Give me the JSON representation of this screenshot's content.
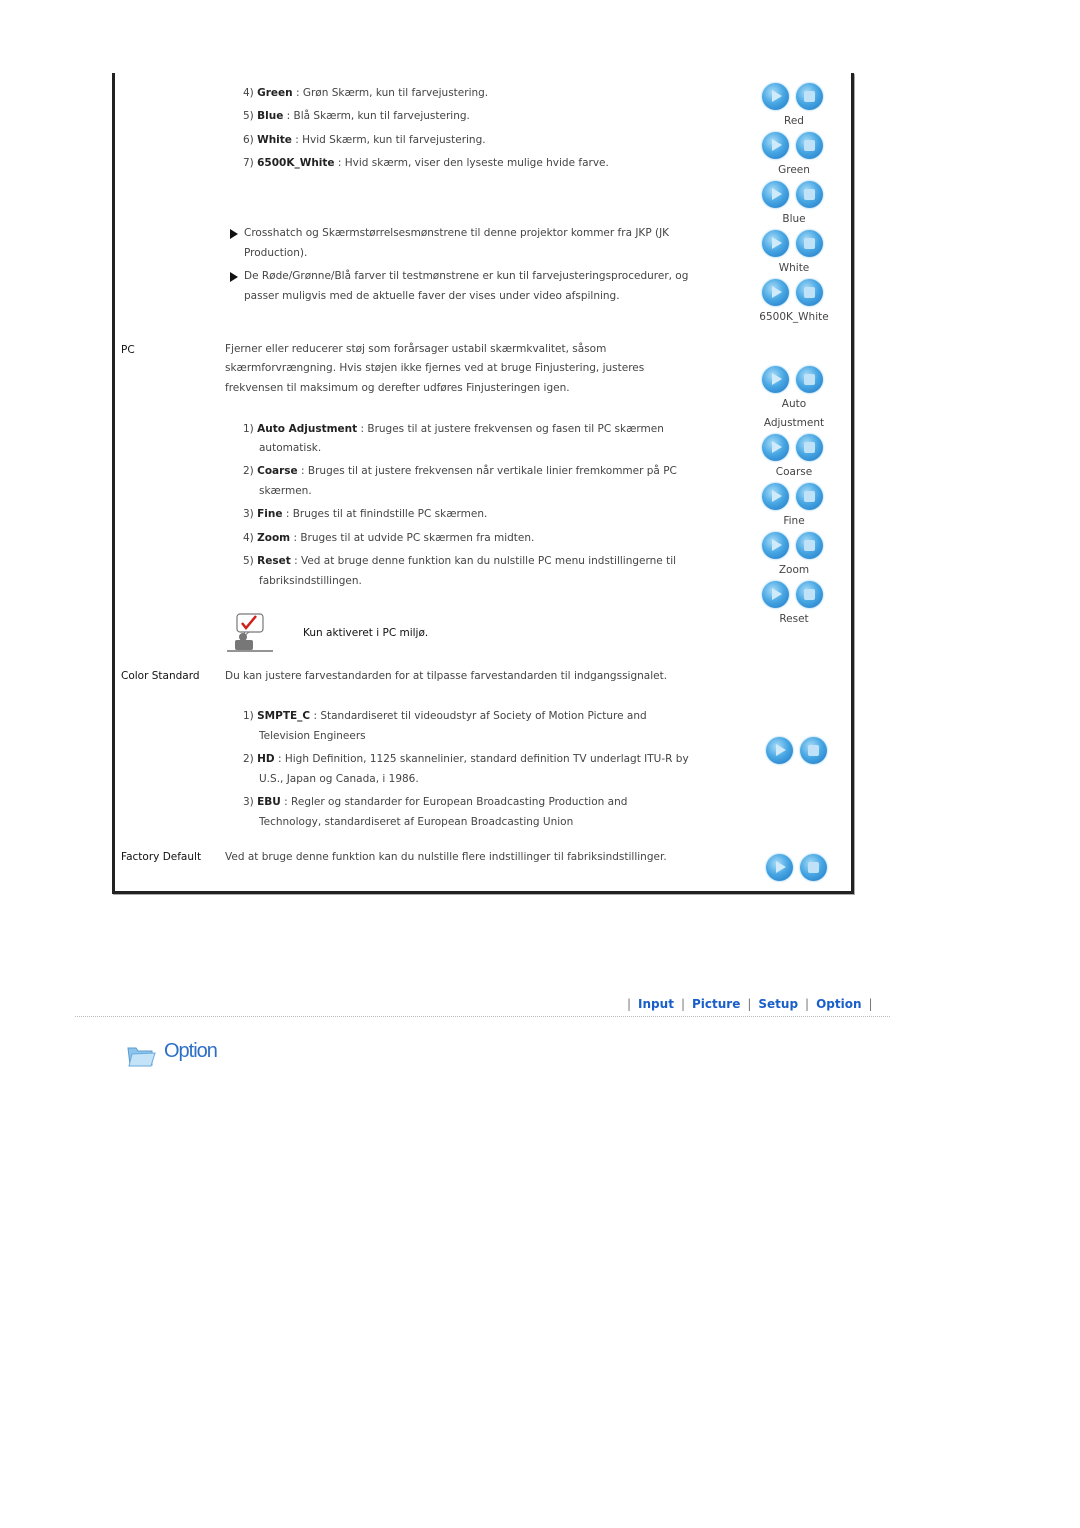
{
  "picture_patterns": {
    "items": [
      {
        "num": "4)",
        "term": "Green",
        "desc": " : Grøn Skærm, kun til farvejustering."
      },
      {
        "num": "5)",
        "term": "Blue",
        "desc": " : Blå Skærm, kun til farvejustering."
      },
      {
        "num": "6)",
        "term": "White",
        "desc": " : Hvid Skærm, kun til farvejustering."
      },
      {
        "num": "7)",
        "term": "6500K_White",
        "desc": " : Hvid skærm, viser den lyseste mulige hvide farve."
      }
    ],
    "notes": [
      {
        "line1": "Crosshatch og Skærmstørrelsesmønstrene til denne projektor kommer fra JKP (JK",
        "line2": "Production)."
      },
      {
        "line1": "De Røde/Grønne/Blå farver til testmønstrene er kun til farvejusteringsprocedurer, og",
        "line2": "passer muligvis med de aktuelle faver der vises under video afspilning."
      }
    ],
    "buttons": [
      "Red",
      "Green",
      "Blue",
      "White",
      "6500K_White"
    ]
  },
  "pc": {
    "label": "PC",
    "desc": [
      "Fjerner eller reducerer støj som forårsager ustabil skærmkvalitet, såsom",
      "skærmforvrængning. Hvis støjen ikke fjernes ved at bruge Finjustering, justeres",
      "frekvensen til maksimum og derefter udføres Finjusteringen igen."
    ],
    "items": [
      {
        "num": "1)",
        "term": "Auto Adjustment",
        "desc": " : Bruges til at justere frekvensen og fasen til PC skærmen",
        "cont": "automatisk."
      },
      {
        "num": "2)",
        "term": "Coarse",
        "desc": " : Bruges til at justere frekvensen når vertikale linier fremkommer på PC",
        "cont": "skærmen."
      },
      {
        "num": "3)",
        "term": "Fine",
        "desc": " : Bruges til at finindstille PC skærmen.",
        "cont": ""
      },
      {
        "num": "4)",
        "term": "Zoom",
        "desc": " : Bruges til at udvide PC skærmen fra midten.",
        "cont": ""
      },
      {
        "num": "5)",
        "term": "Reset",
        "desc": " : Ved at bruge denne funktion kan du nulstille PC menu indstillingerne til",
        "cont": "fabriksindstillingen."
      }
    ],
    "note": "Kun aktiveret i PC miljø.",
    "buttons": [
      "Auto",
      "Adjustment",
      "Coarse",
      "Fine",
      "Zoom",
      "Reset"
    ]
  },
  "color_standard": {
    "label": "Color Standard",
    "desc": "Du kan justere farvestandarden for at tilpasse farvestandarden til indgangssignalet.",
    "items": [
      {
        "num": "1)",
        "term": "SMPTE_C",
        "desc": " : Standardiseret til videoudstyr af Society of Motion Picture and",
        "cont": "Television Engineers"
      },
      {
        "num": "2)",
        "term": "HD",
        "desc": " : High Definition, 1125 skannelinier, standard definition TV underlagt ITU-R by",
        "cont": "U.S., Japan og Canada, i 1986."
      },
      {
        "num": "3)",
        "term": "EBU",
        "desc": " : Regler og standarder for European Broadcasting Production and",
        "cont": "Technology, standardiseret af European Broadcasting Union"
      }
    ]
  },
  "factory_default": {
    "label": "Factory Default",
    "desc": "Ved at bruge denne funktion kan du nulstille flere indstillinger til fabriksindstillinger."
  },
  "nav": {
    "links": [
      "Input",
      "Picture",
      "Setup",
      "Option"
    ]
  },
  "section_title": "Option"
}
